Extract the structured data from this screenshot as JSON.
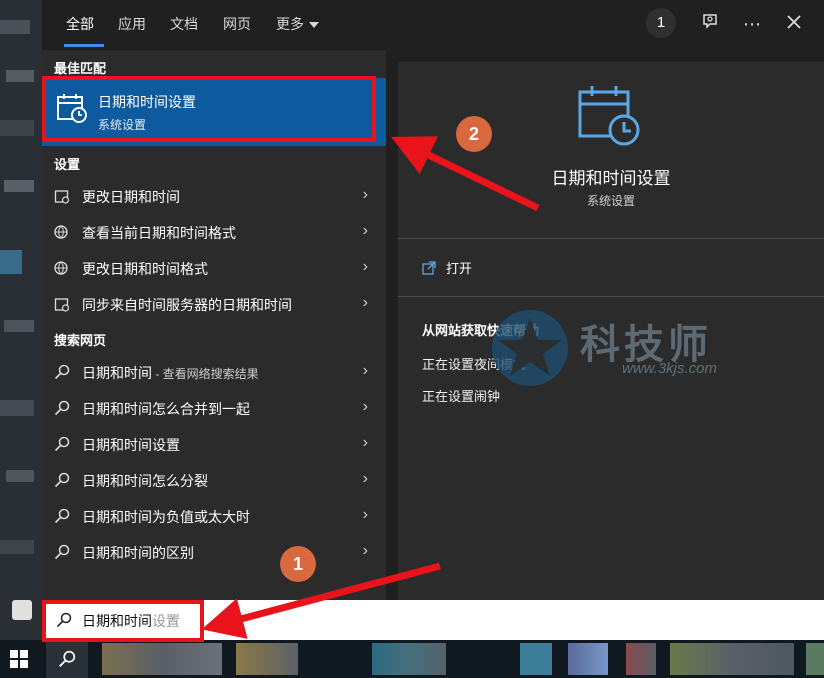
{
  "tabs": {
    "all": "全部",
    "apps": "应用",
    "documents": "文档",
    "web": "网页",
    "more": "更多"
  },
  "header": {
    "badge_count": "1"
  },
  "best_match": {
    "heading": "最佳匹配",
    "title": "日期和时间设置",
    "subtitle": "系统设置"
  },
  "settings": {
    "heading": "设置",
    "items": [
      {
        "label": "更改日期和时间"
      },
      {
        "label": "查看当前日期和时间格式"
      },
      {
        "label": "更改日期和时间格式"
      },
      {
        "label": "同步来自时间服务器的日期和时间"
      }
    ]
  },
  "web_search": {
    "heading": "搜索网页",
    "items": [
      {
        "label": "日期和时间",
        "suffix": " - 查看网络搜索结果"
      },
      {
        "label": "日期和时间怎么合并到一起"
      },
      {
        "label": "日期和时间设置"
      },
      {
        "label": "日期和时间怎么分裂"
      },
      {
        "label": "日期和时间为负值或太大时"
      },
      {
        "label": "日期和时间的区别"
      }
    ]
  },
  "preview": {
    "title": "日期和时间设置",
    "subtitle": "系统设置",
    "open_label": "打开",
    "help_heading": "从网站获取快速帮助",
    "help_links": [
      "正在设置夜间模式",
      "正在设置闹钟"
    ]
  },
  "search": {
    "typed": "日期和时间",
    "hint": "设置"
  },
  "annotations": {
    "badge_1": "1",
    "badge_2": "2"
  },
  "watermark": {
    "brand": "科技师",
    "url": "www.3kjs.com"
  },
  "colors": {
    "accent": "#0e5a9e",
    "annotation_red": "#e8131b",
    "badge_orange": "#d9683e"
  }
}
